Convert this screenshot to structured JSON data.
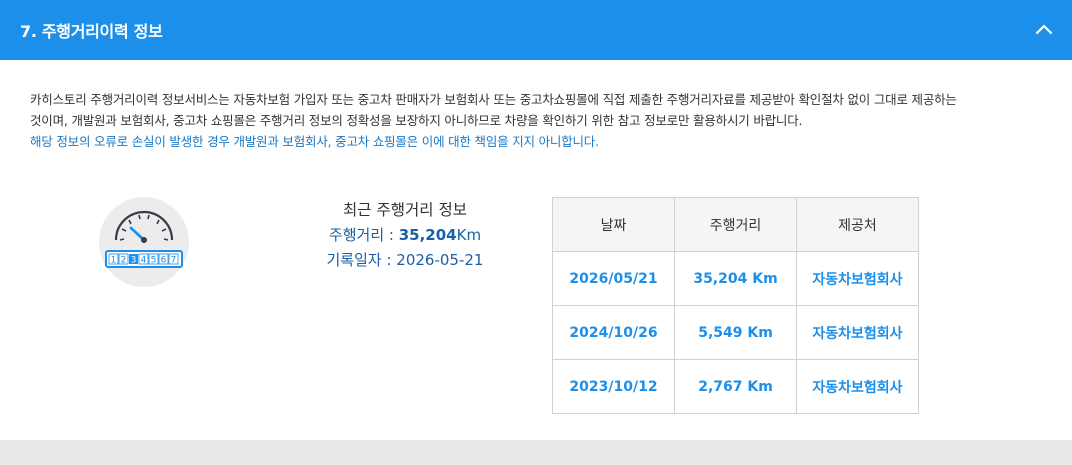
{
  "header": {
    "title": "7. 주행거리이력 정보",
    "collapse_icon": "chevron-up-icon"
  },
  "description": {
    "line1": "카히스토리 주행거리이력 정보서비스는 자동차보험 가입자 또는 중고차 판매자가 보험회사 또는 중고차쇼핑몰에 직접 제출한 주행거리자료를 제공받아 확인절차 없이 그대로 제공하는",
    "line2": "것이며, 개발원과 보험회사, 중고차 쇼핑몰은 주행거리 정보의 정확성을 보장하지 아니하므로 차량을 확인하기 위한 참고 정보로만 활용하시기 바랍니다.",
    "notice": "해당 정보의 오류로 손실이 발생한 경우 개발원과 보험회사, 중고차 쇼핑몰은 이에 대한 책임을 지지 아니합니다."
  },
  "odometer_icon": {
    "name": "odometer-icon",
    "digits": [
      "1",
      "2",
      "3",
      "4",
      "5",
      "6",
      "7"
    ]
  },
  "recent": {
    "title": "최근 주행거리 정보",
    "mileage_label": "주행거리 : ",
    "mileage_value": "35,204",
    "mileage_unit": "Km",
    "date_label": "기록일자 : ",
    "date_value": "2026-05-21"
  },
  "history_table": {
    "headers": [
      "날짜",
      "주행거리",
      "제공처"
    ],
    "rows": [
      {
        "date": "2026/05/21",
        "mileage": "35,204 Km",
        "provider": "자동차보험회사"
      },
      {
        "date": "2024/10/26",
        "mileage": "5,549 Km",
        "provider": "자동차보험회사"
      },
      {
        "date": "2023/10/12",
        "mileage": "2,767 Km",
        "provider": "자동차보험회사"
      }
    ]
  },
  "colors": {
    "header_bg": "#1b8fea",
    "accent_text": "#1b8fea",
    "notice_text": "#1b78c4"
  }
}
